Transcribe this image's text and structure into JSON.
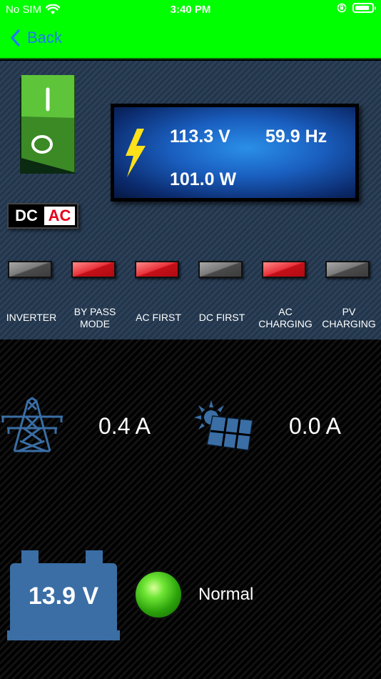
{
  "status_bar": {
    "carrier": "No SIM",
    "time": "3:40 PM",
    "battery_level": 0.85
  },
  "nav": {
    "back_label": "Back"
  },
  "switch": {
    "top_mark": "I",
    "bottom_mark": "O"
  },
  "badge": {
    "dc": "DC",
    "ac": "AC"
  },
  "display": {
    "voltage": "113.3 V",
    "frequency": "59.9 Hz",
    "power": "101.0 W"
  },
  "indicators": [
    {
      "label": "INVERTER",
      "state": "off"
    },
    {
      "label": "BY PASS MODE",
      "state": "on"
    },
    {
      "label": "AC FIRST",
      "state": "on"
    },
    {
      "label": "DC FIRST",
      "state": "off"
    },
    {
      "label": "AC CHARGING",
      "state": "on"
    },
    {
      "label": "PV CHARGING",
      "state": "off"
    }
  ],
  "grid": {
    "icon": "power-tower-icon",
    "current": "0.4 A"
  },
  "solar": {
    "icon": "solar-panel-icon",
    "current": "0.0 A"
  },
  "battery": {
    "voltage": "13.9 V",
    "status": "Normal",
    "status_color": "#3ccf14"
  },
  "colors": {
    "nav_bg": "#00ff00",
    "link": "#1d7cf2",
    "icon_blue": "#3a6ea5",
    "indicator_on": "#e8323a"
  }
}
